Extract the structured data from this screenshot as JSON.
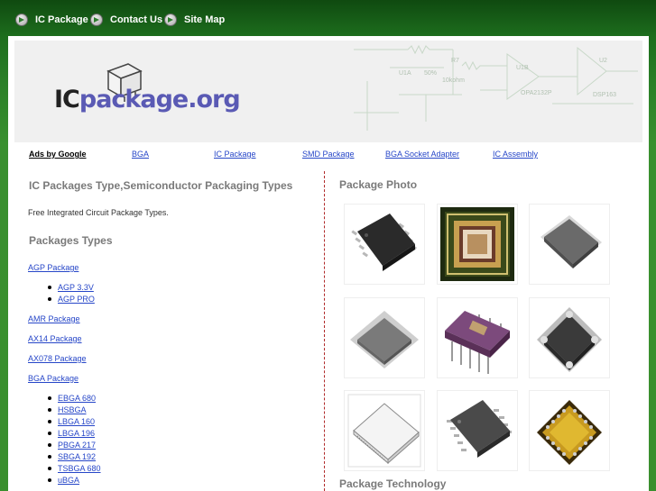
{
  "topnav": {
    "items": [
      {
        "label": "IC Package",
        "icon": "arrow-circle-icon"
      },
      {
        "label": "Contact Us",
        "icon": "arrow-circle-icon"
      },
      {
        "label": "Site Map",
        "icon": "arrow-circle-icon"
      }
    ]
  },
  "header": {
    "logo_ic": "IC",
    "logo_rest": "package.org",
    "circuit_labels": {
      "r7": "R7",
      "ohm": "10kohm",
      "u1a": "U1A",
      "u1b": "U1B",
      "u2": "U2",
      "pct": "50%",
      "opa": "OPA2132P",
      "dsp": "DSP163"
    }
  },
  "linkbar": {
    "items": [
      {
        "label": "Ads by Google",
        "type": "ads"
      },
      {
        "label": "BGA"
      },
      {
        "label": "IC Package"
      },
      {
        "label": "SMD Package"
      },
      {
        "label": "BGA Socket Adapter"
      },
      {
        "label": "IC Assembly"
      }
    ]
  },
  "main": {
    "title": "IC Packages Type,Semiconductor Packaging Types",
    "description": "Free Integrated Circuit Package Types.",
    "types_heading": "Packages Types",
    "packages": [
      {
        "label": "AGP Package",
        "sub": [
          "AGP 3.3V",
          "AGP PRO"
        ]
      },
      {
        "label": "AMR Package",
        "sub": []
      },
      {
        "label": "AX14 Package",
        "sub": []
      },
      {
        "label": "AX078 Package",
        "sub": []
      },
      {
        "label": "BGA Package",
        "sub": [
          "EBGA 680",
          "HSBGA",
          "LBGA 160",
          "LBGA 196",
          "PBGA 217",
          "SBGA 192",
          "TSBGA 680",
          "uBGA"
        ]
      }
    ]
  },
  "sidebar": {
    "photo_heading": "Package Photo",
    "tech_heading": "Package Technology",
    "photos": [
      {
        "name": "soic-chip-image"
      },
      {
        "name": "bga-die-image"
      },
      {
        "name": "qfp-chip-image"
      },
      {
        "name": "tqfp-chip-image"
      },
      {
        "name": "cerdip-chip-image"
      },
      {
        "name": "qfn-chip-image"
      },
      {
        "name": "tsop-chip-image"
      },
      {
        "name": "sop-chip-image"
      },
      {
        "name": "plcc-gold-image"
      }
    ]
  },
  "colors": {
    "header_green": "#1d6d1d",
    "link_blue": "#2646c8",
    "divider_red": "#b02a2a",
    "heading_gray": "#7a7a7a"
  }
}
